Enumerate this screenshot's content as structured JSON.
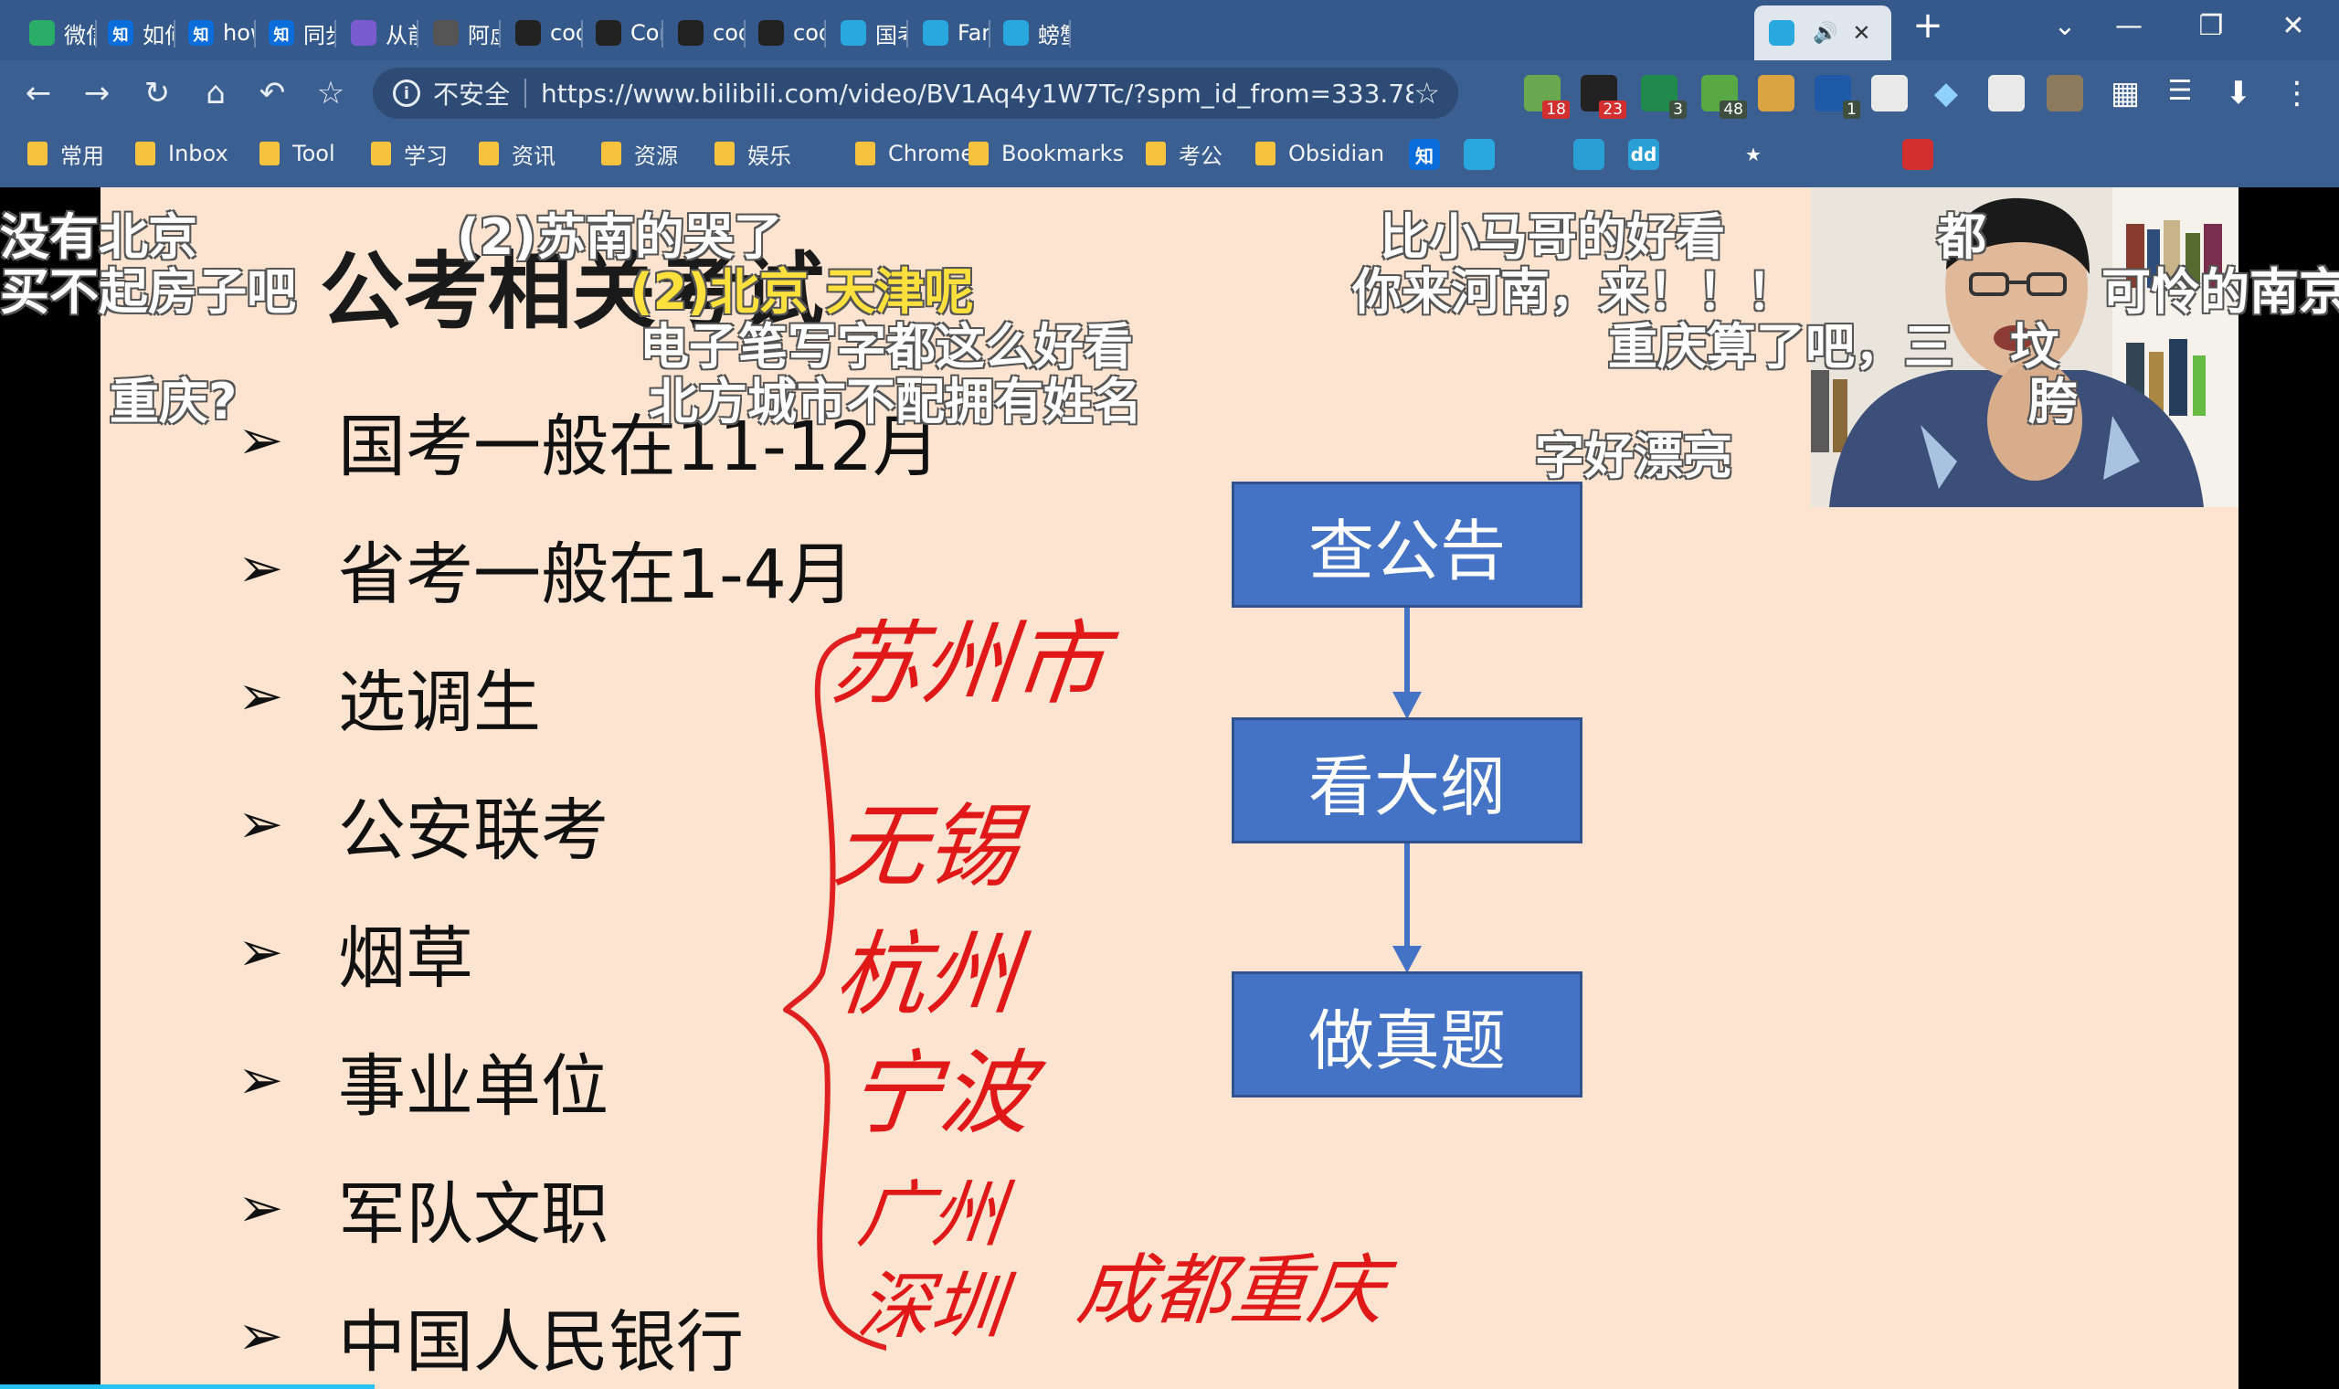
{
  "tabs": [
    {
      "title": "微信文",
      "fav": "",
      "favbg": "#2aae67",
      "icon": "wechat-icon"
    },
    {
      "title": "如何",
      "fav": "知",
      "favbg": "#0a6dd9",
      "icon": "zhihu-icon"
    },
    {
      "title": "howic",
      "fav": "知",
      "favbg": "#0a6dd9",
      "icon": "zhihu-icon"
    },
    {
      "title": "同步",
      "fav": "知",
      "favbg": "#0a6dd9",
      "icon": "zhihu-icon"
    },
    {
      "title": "从前的",
      "fav": "",
      "favbg": "#7b5ccf",
      "icon": "puzzle-icon"
    },
    {
      "title": "阿虚",
      "fav": "",
      "favbg": "#555555",
      "icon": "avatar-icon"
    },
    {
      "title": "coder",
      "fav": "",
      "favbg": "#222222",
      "icon": "github-icon"
    },
    {
      "title": "Comn",
      "fav": "",
      "favbg": "#222222",
      "icon": "github-icon"
    },
    {
      "title": "coder",
      "fav": "",
      "favbg": "#222222",
      "icon": "github-icon"
    },
    {
      "title": "coder",
      "fav": "",
      "favbg": "#222222",
      "icon": "github-icon"
    },
    {
      "title": "国考现",
      "fav": "",
      "favbg": "#29a8e0",
      "icon": "bilibili-icon"
    },
    {
      "title": "Farrrc",
      "fav": "",
      "favbg": "#29a8e0",
      "icon": "bilibili-icon"
    },
    {
      "title": "螃蟹姐",
      "fav": "",
      "favbg": "#29a8e0",
      "icon": "bilibili-icon"
    }
  ],
  "active_tab": {
    "fav_icon": "bilibili-icon",
    "audio_icon": "speaker-icon",
    "close": "✕"
  },
  "window": {
    "new_tab": "+",
    "dropdown": "⌄",
    "minimize": "—",
    "restore": "❐",
    "close": "✕"
  },
  "toolbar": {
    "back": "←",
    "forward": "→",
    "reload": "↻",
    "home": "⌂",
    "undo": "↶",
    "bookmark": "☆",
    "security": "不安全",
    "url": "https://www.bilibili.com/video/BV1Aq4y1W7Tc/?spm_id_from=333.78...",
    "star": "☆",
    "badges": [
      "18",
      "23",
      "3",
      "48",
      "1"
    ]
  },
  "bookmarks": [
    "常用",
    "Inbox",
    "Tool",
    "学习",
    "资讯",
    "资源",
    "娱乐",
    "Chrome",
    "Bookmarks",
    "考公",
    "Obsidian"
  ],
  "bookmark_icons": [
    "知",
    "",
    "",
    "",
    "dd",
    "",
    "★",
    "",
    "",
    ""
  ],
  "slide": {
    "title": "公考相关考试",
    "items": [
      "国考一般在11-12月",
      "省考一般在1-4月",
      "选调生",
      "公安联考",
      "烟草",
      "事业单位",
      "军队文职",
      "中国人民银行"
    ],
    "arrow": "➢",
    "flow": [
      "查公告",
      "看大纲",
      "做真题"
    ],
    "handwriting": [
      "苏州市",
      "无锡",
      "杭州",
      "宁波",
      "广州",
      "深圳",
      "成都重庆"
    ]
  },
  "danmaku": [
    {
      "text": "没有北京",
      "style": "white"
    },
    {
      "text": "买不起房子吧",
      "style": "white"
    },
    {
      "text": "(2)苏南的哭了",
      "style": "white"
    },
    {
      "text": "(2)北京 天津呢",
      "style": "gold"
    },
    {
      "text": "电子笔写字都这么好看",
      "style": "white"
    },
    {
      "text": "北方城市不配拥有姓名",
      "style": "white"
    },
    {
      "text": "重庆?",
      "style": "white"
    },
    {
      "text": "比小马哥的好看",
      "style": "white"
    },
    {
      "text": "你来河南，来！！！",
      "style": "white"
    },
    {
      "text": "重庆算了吧，三",
      "style": "white"
    },
    {
      "text": "字好漂亮",
      "style": "white"
    },
    {
      "text": "可怜的南京",
      "style": "white"
    },
    {
      "text": "都",
      "style": "white"
    },
    {
      "text": "坟",
      "style": "white"
    },
    {
      "text": "胯",
      "style": "white"
    }
  ],
  "colors": {
    "chrome": "#3b5f91",
    "slide_bg": "#fde4d1",
    "flow": "#4472c4",
    "ink": "#e01818",
    "progress": "#27c2f5"
  }
}
